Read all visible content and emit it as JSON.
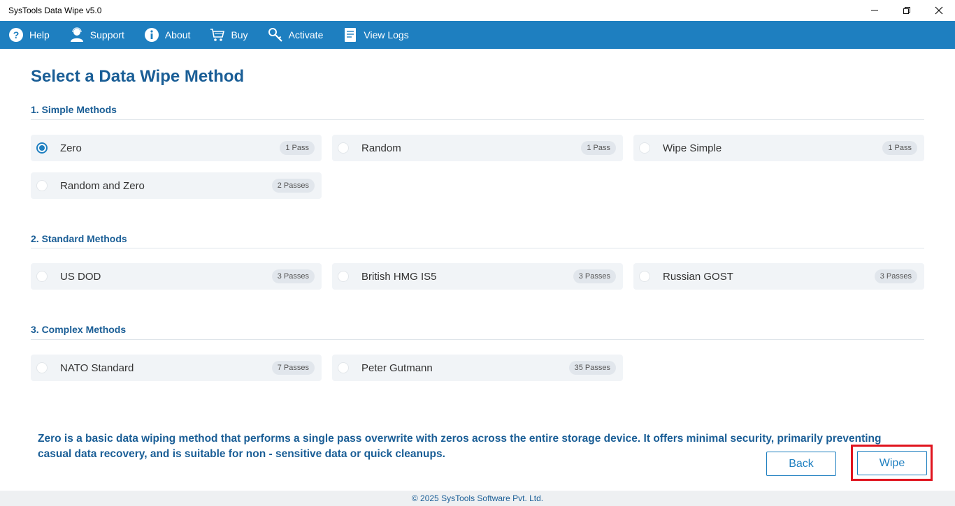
{
  "window": {
    "title": "SysTools Data Wipe v5.0",
    "minimize_icon": "minimize-icon",
    "maximize_icon": "restore-icon",
    "close_icon": "close-icon"
  },
  "toolbar": {
    "background": "#1e7fc0",
    "items": [
      {
        "label": "Help",
        "icon": "help-icon"
      },
      {
        "label": "Support",
        "icon": "support-icon"
      },
      {
        "label": "About",
        "icon": "info-icon"
      },
      {
        "label": "Buy",
        "icon": "cart-icon"
      },
      {
        "label": "Activate",
        "icon": "key-icon"
      },
      {
        "label": "View Logs",
        "icon": "log-icon"
      }
    ]
  },
  "main": {
    "title": "Select a Data Wipe Method",
    "sections": [
      {
        "title": "1. Simple Methods",
        "options": [
          {
            "label": "Zero",
            "passes": "1 Pass",
            "selected": true
          },
          {
            "label": "Random",
            "passes": "1 Pass",
            "selected": false
          },
          {
            "label": "Wipe Simple",
            "passes": "1 Pass",
            "selected": false
          },
          {
            "label": "Random and Zero",
            "passes": "2 Passes",
            "selected": false
          }
        ]
      },
      {
        "title": "2. Standard Methods",
        "options": [
          {
            "label": "US DOD",
            "passes": "3 Passes",
            "selected": false
          },
          {
            "label": "British HMG IS5",
            "passes": "3 Passes",
            "selected": false
          },
          {
            "label": "Russian GOST",
            "passes": "3 Passes",
            "selected": false
          }
        ]
      },
      {
        "title": "3. Complex Methods",
        "options": [
          {
            "label": "NATO Standard",
            "passes": "7 Passes",
            "selected": false
          },
          {
            "label": "Peter Gutmann",
            "passes": "35 Passes",
            "selected": false
          }
        ]
      }
    ],
    "description": "Zero is a basic data wiping method that performs a single pass overwrite with zeros across the entire storage device. It offers minimal security, primarily preventing casual data recovery, and is suitable for non - sensitive data or quick cleanups."
  },
  "buttons": {
    "back": "Back",
    "wipe": "Wipe"
  },
  "footer": {
    "text": "© 2025 SysTools Software Pvt. Ltd."
  },
  "colors": {
    "accent": "#1e7fc0",
    "heading": "#1a5e96",
    "highlight": "#e0141e"
  }
}
